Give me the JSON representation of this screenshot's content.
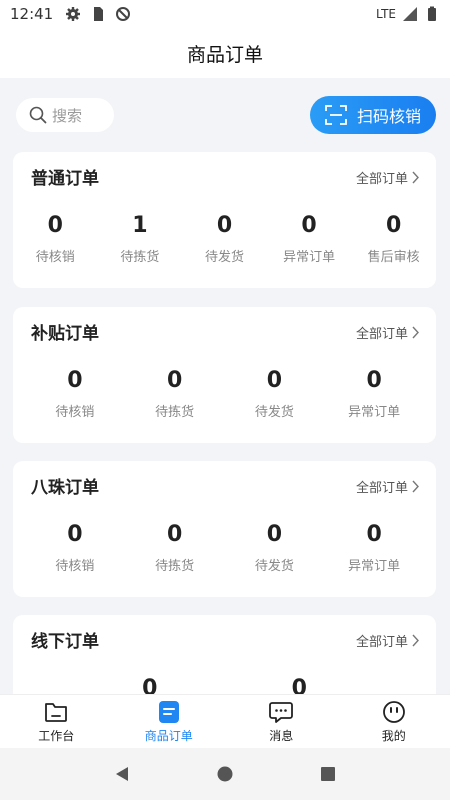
{
  "status_bar": {
    "time": "12:41",
    "network": "LTE"
  },
  "header": {
    "title": "商品订单"
  },
  "search": {
    "placeholder": "搜索"
  },
  "scan": {
    "label": "扫码核销"
  },
  "cards": [
    {
      "title": "普通订单",
      "link": "全部订单",
      "stats": [
        {
          "value": "0",
          "label": "待核销"
        },
        {
          "value": "1",
          "label": "待拣货"
        },
        {
          "value": "0",
          "label": "待发货"
        },
        {
          "value": "0",
          "label": "异常订单"
        },
        {
          "value": "0",
          "label": "售后审核"
        }
      ]
    },
    {
      "title": "补贴订单",
      "link": "全部订单",
      "stats": [
        {
          "value": "0",
          "label": "待核销"
        },
        {
          "value": "0",
          "label": "待拣货"
        },
        {
          "value": "0",
          "label": "待发货"
        },
        {
          "value": "0",
          "label": "异常订单"
        }
      ]
    },
    {
      "title": "八珠订单",
      "link": "全部订单",
      "stats": [
        {
          "value": "0",
          "label": "待核销"
        },
        {
          "value": "0",
          "label": "待拣货"
        },
        {
          "value": "0",
          "label": "待发货"
        },
        {
          "value": "0",
          "label": "异常订单"
        }
      ]
    },
    {
      "title": "线下订单",
      "link": "全部订单",
      "stats": [
        {
          "value": "0",
          "label": ""
        },
        {
          "value": "0",
          "label": ""
        }
      ]
    }
  ],
  "tabs": [
    {
      "label": "工作台",
      "icon": "folder-icon"
    },
    {
      "label": "商品订单",
      "icon": "order-doc-icon"
    },
    {
      "label": "消息",
      "icon": "message-icon"
    },
    {
      "label": "我的",
      "icon": "smiley-icon"
    }
  ],
  "colors": {
    "accent": "#1f86f2",
    "background": "#f3f4f7"
  }
}
